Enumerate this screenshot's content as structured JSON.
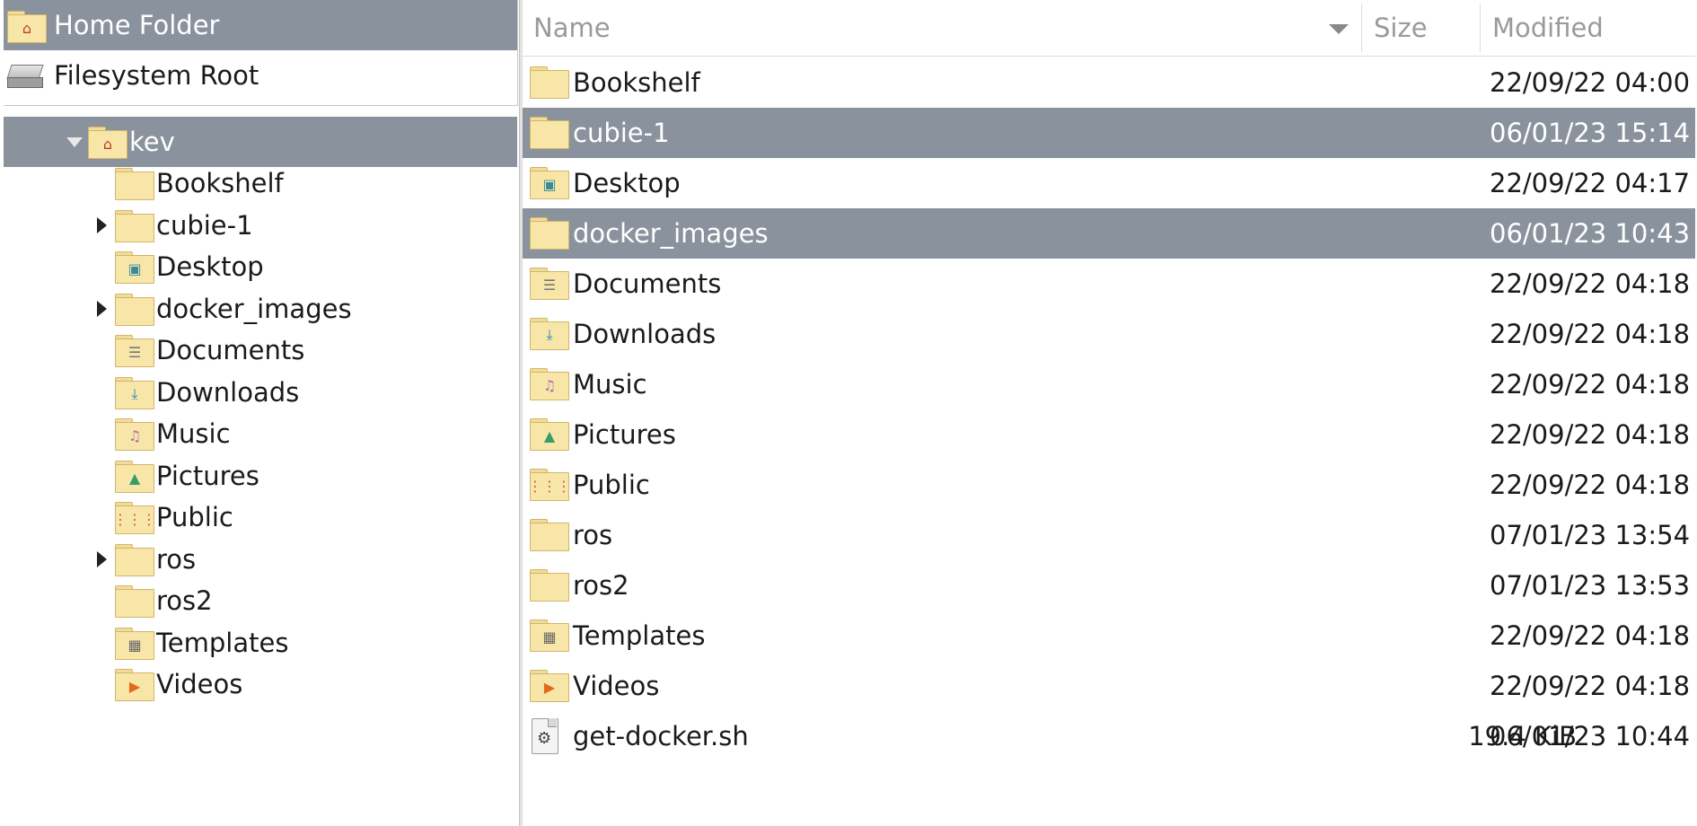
{
  "places": [
    {
      "label": "Home Folder",
      "icon": "home-folder-icon",
      "selected": true
    },
    {
      "label": "Filesystem Root",
      "icon": "drive-icon",
      "selected": false
    }
  ],
  "tree": {
    "root": {
      "label": "kev",
      "icon": "home-folder-icon",
      "expanded": true,
      "selected": true
    },
    "children": [
      {
        "label": "Bookshelf",
        "icon": "folder-icon",
        "expandable": false
      },
      {
        "label": "cubie-1",
        "icon": "folder-icon",
        "expandable": true
      },
      {
        "label": "Desktop",
        "icon": "desktop-folder-icon",
        "expandable": false
      },
      {
        "label": "docker_images",
        "icon": "folder-icon",
        "expandable": true
      },
      {
        "label": "Documents",
        "icon": "documents-folder-icon",
        "expandable": false
      },
      {
        "label": "Downloads",
        "icon": "downloads-folder-icon",
        "expandable": false
      },
      {
        "label": "Music",
        "icon": "music-folder-icon",
        "expandable": false
      },
      {
        "label": "Pictures",
        "icon": "pictures-folder-icon",
        "expandable": false
      },
      {
        "label": "Public",
        "icon": "public-folder-icon",
        "expandable": false
      },
      {
        "label": "ros",
        "icon": "folder-icon",
        "expandable": true
      },
      {
        "label": "ros2",
        "icon": "folder-icon",
        "expandable": false
      },
      {
        "label": "Templates",
        "icon": "templates-folder-icon",
        "expandable": false
      },
      {
        "label": "Videos",
        "icon": "videos-folder-icon",
        "expandable": false
      }
    ]
  },
  "columns": {
    "name": "Name",
    "size": "Size",
    "modified": "Modified"
  },
  "files": [
    {
      "name": "Bookshelf",
      "size": "",
      "modified": "22/09/22 04:00",
      "icon": "folder-icon",
      "selected": false
    },
    {
      "name": "cubie-1",
      "size": "",
      "modified": "06/01/23 15:14",
      "icon": "folder-icon",
      "selected": true
    },
    {
      "name": "Desktop",
      "size": "",
      "modified": "22/09/22 04:17",
      "icon": "desktop-folder-icon",
      "selected": false
    },
    {
      "name": "docker_images",
      "size": "",
      "modified": "06/01/23 10:43",
      "icon": "folder-icon",
      "selected": true
    },
    {
      "name": "Documents",
      "size": "",
      "modified": "22/09/22 04:18",
      "icon": "documents-folder-icon",
      "selected": false
    },
    {
      "name": "Downloads",
      "size": "",
      "modified": "22/09/22 04:18",
      "icon": "downloads-folder-icon",
      "selected": false
    },
    {
      "name": "Music",
      "size": "",
      "modified": "22/09/22 04:18",
      "icon": "music-folder-icon",
      "selected": false
    },
    {
      "name": "Pictures",
      "size": "",
      "modified": "22/09/22 04:18",
      "icon": "pictures-folder-icon",
      "selected": false
    },
    {
      "name": "Public",
      "size": "",
      "modified": "22/09/22 04:18",
      "icon": "public-folder-icon",
      "selected": false
    },
    {
      "name": "ros",
      "size": "",
      "modified": "07/01/23 13:54",
      "icon": "folder-icon",
      "selected": false
    },
    {
      "name": "ros2",
      "size": "",
      "modified": "07/01/23 13:53",
      "icon": "folder-icon",
      "selected": false
    },
    {
      "name": "Templates",
      "size": "",
      "modified": "22/09/22 04:18",
      "icon": "templates-folder-icon",
      "selected": false
    },
    {
      "name": "Videos",
      "size": "",
      "modified": "22/09/22 04:18",
      "icon": "videos-folder-icon",
      "selected": false
    },
    {
      "name": "get-docker.sh",
      "size": "19.4 KiB",
      "modified": "06/01/23 10:44",
      "icon": "script-file-icon",
      "selected": false
    }
  ],
  "colors": {
    "selection": "#8a939d",
    "folder": "#f8e6a8",
    "home": "#c0392b"
  }
}
